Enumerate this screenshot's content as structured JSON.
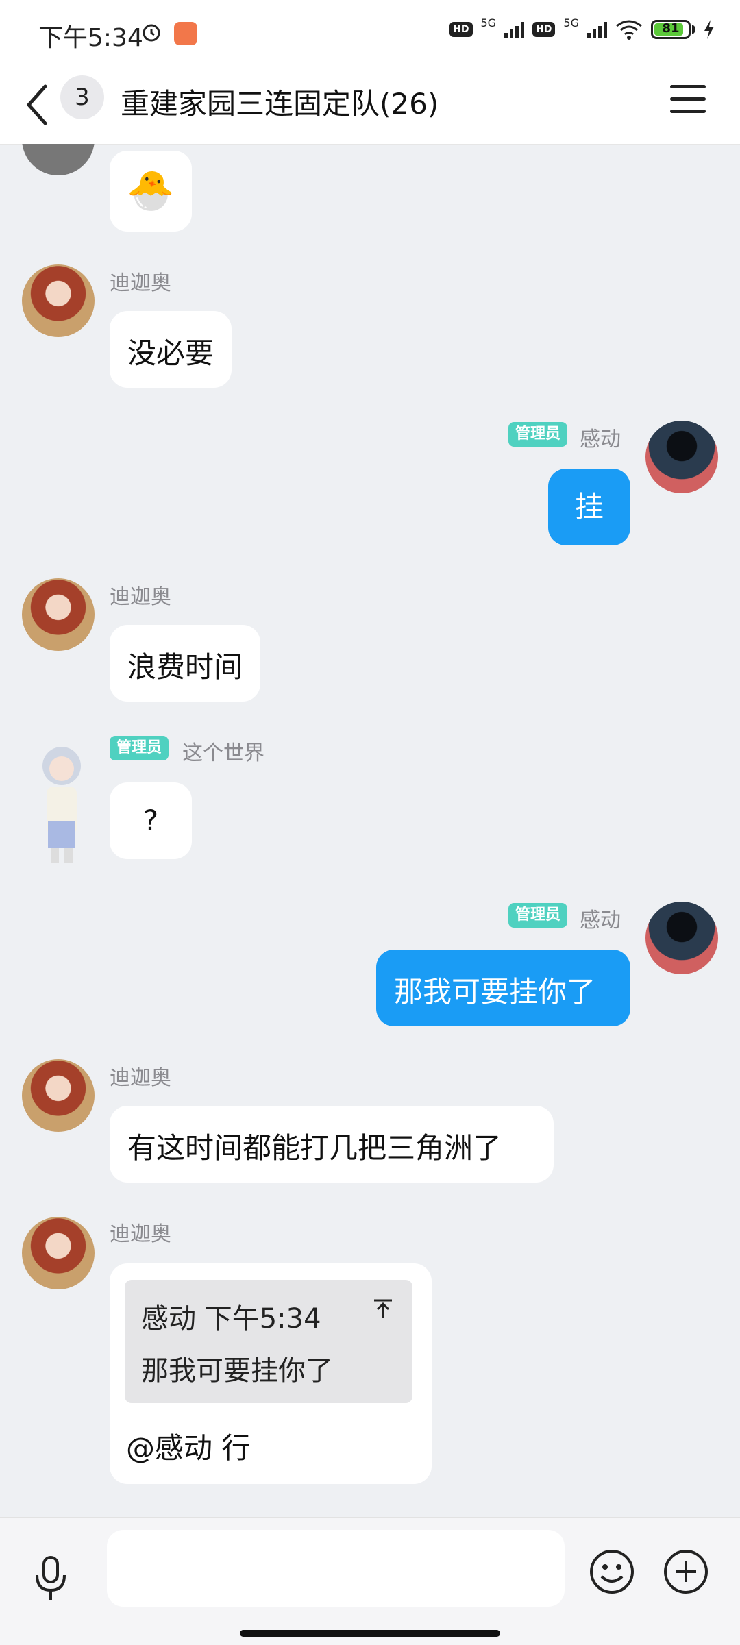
{
  "status_bar": {
    "time": "下午5:34",
    "network_1": "5G",
    "network_2": "5G",
    "hd_1": "HD",
    "hd_2": "HD",
    "battery": "81",
    "battery_color": "#5cc93a"
  },
  "header": {
    "unread_count": "3",
    "title": "重建家园三连固定队(26)"
  },
  "admin_badge": "管理员",
  "messages": [
    {
      "sender": "",
      "text": "🐣",
      "mine": false
    },
    {
      "sender": "迪迦奥",
      "text": "没必要",
      "mine": false
    },
    {
      "sender": "感动",
      "text": "挂",
      "mine": true
    },
    {
      "sender": "迪迦奥",
      "text": "浪费时间",
      "mine": false
    },
    {
      "sender": "这个世界",
      "text": "?",
      "mine": false
    },
    {
      "sender": "感动",
      "text": "那我可要挂你了",
      "mine": true
    },
    {
      "sender": "迪迦奥",
      "text": "有这时间都能打几把三角洲了",
      "mine": false
    },
    {
      "sender": "迪迦奥",
      "quote_head": "感动 下午5:34",
      "quote_text": "那我可要挂你了",
      "text": "@感动 行",
      "mine": false
    }
  ],
  "colors": {
    "my_bubble": "#1a9cf5",
    "admin_badge": "#4fd1c0",
    "background": "#eef0f3"
  },
  "icons": [
    "alarm-icon",
    "back-icon",
    "menu-icon",
    "mic-icon",
    "emoji-icon",
    "plus-icon",
    "quote-up-icon"
  ],
  "input": {
    "value": "",
    "placeholder": ""
  }
}
